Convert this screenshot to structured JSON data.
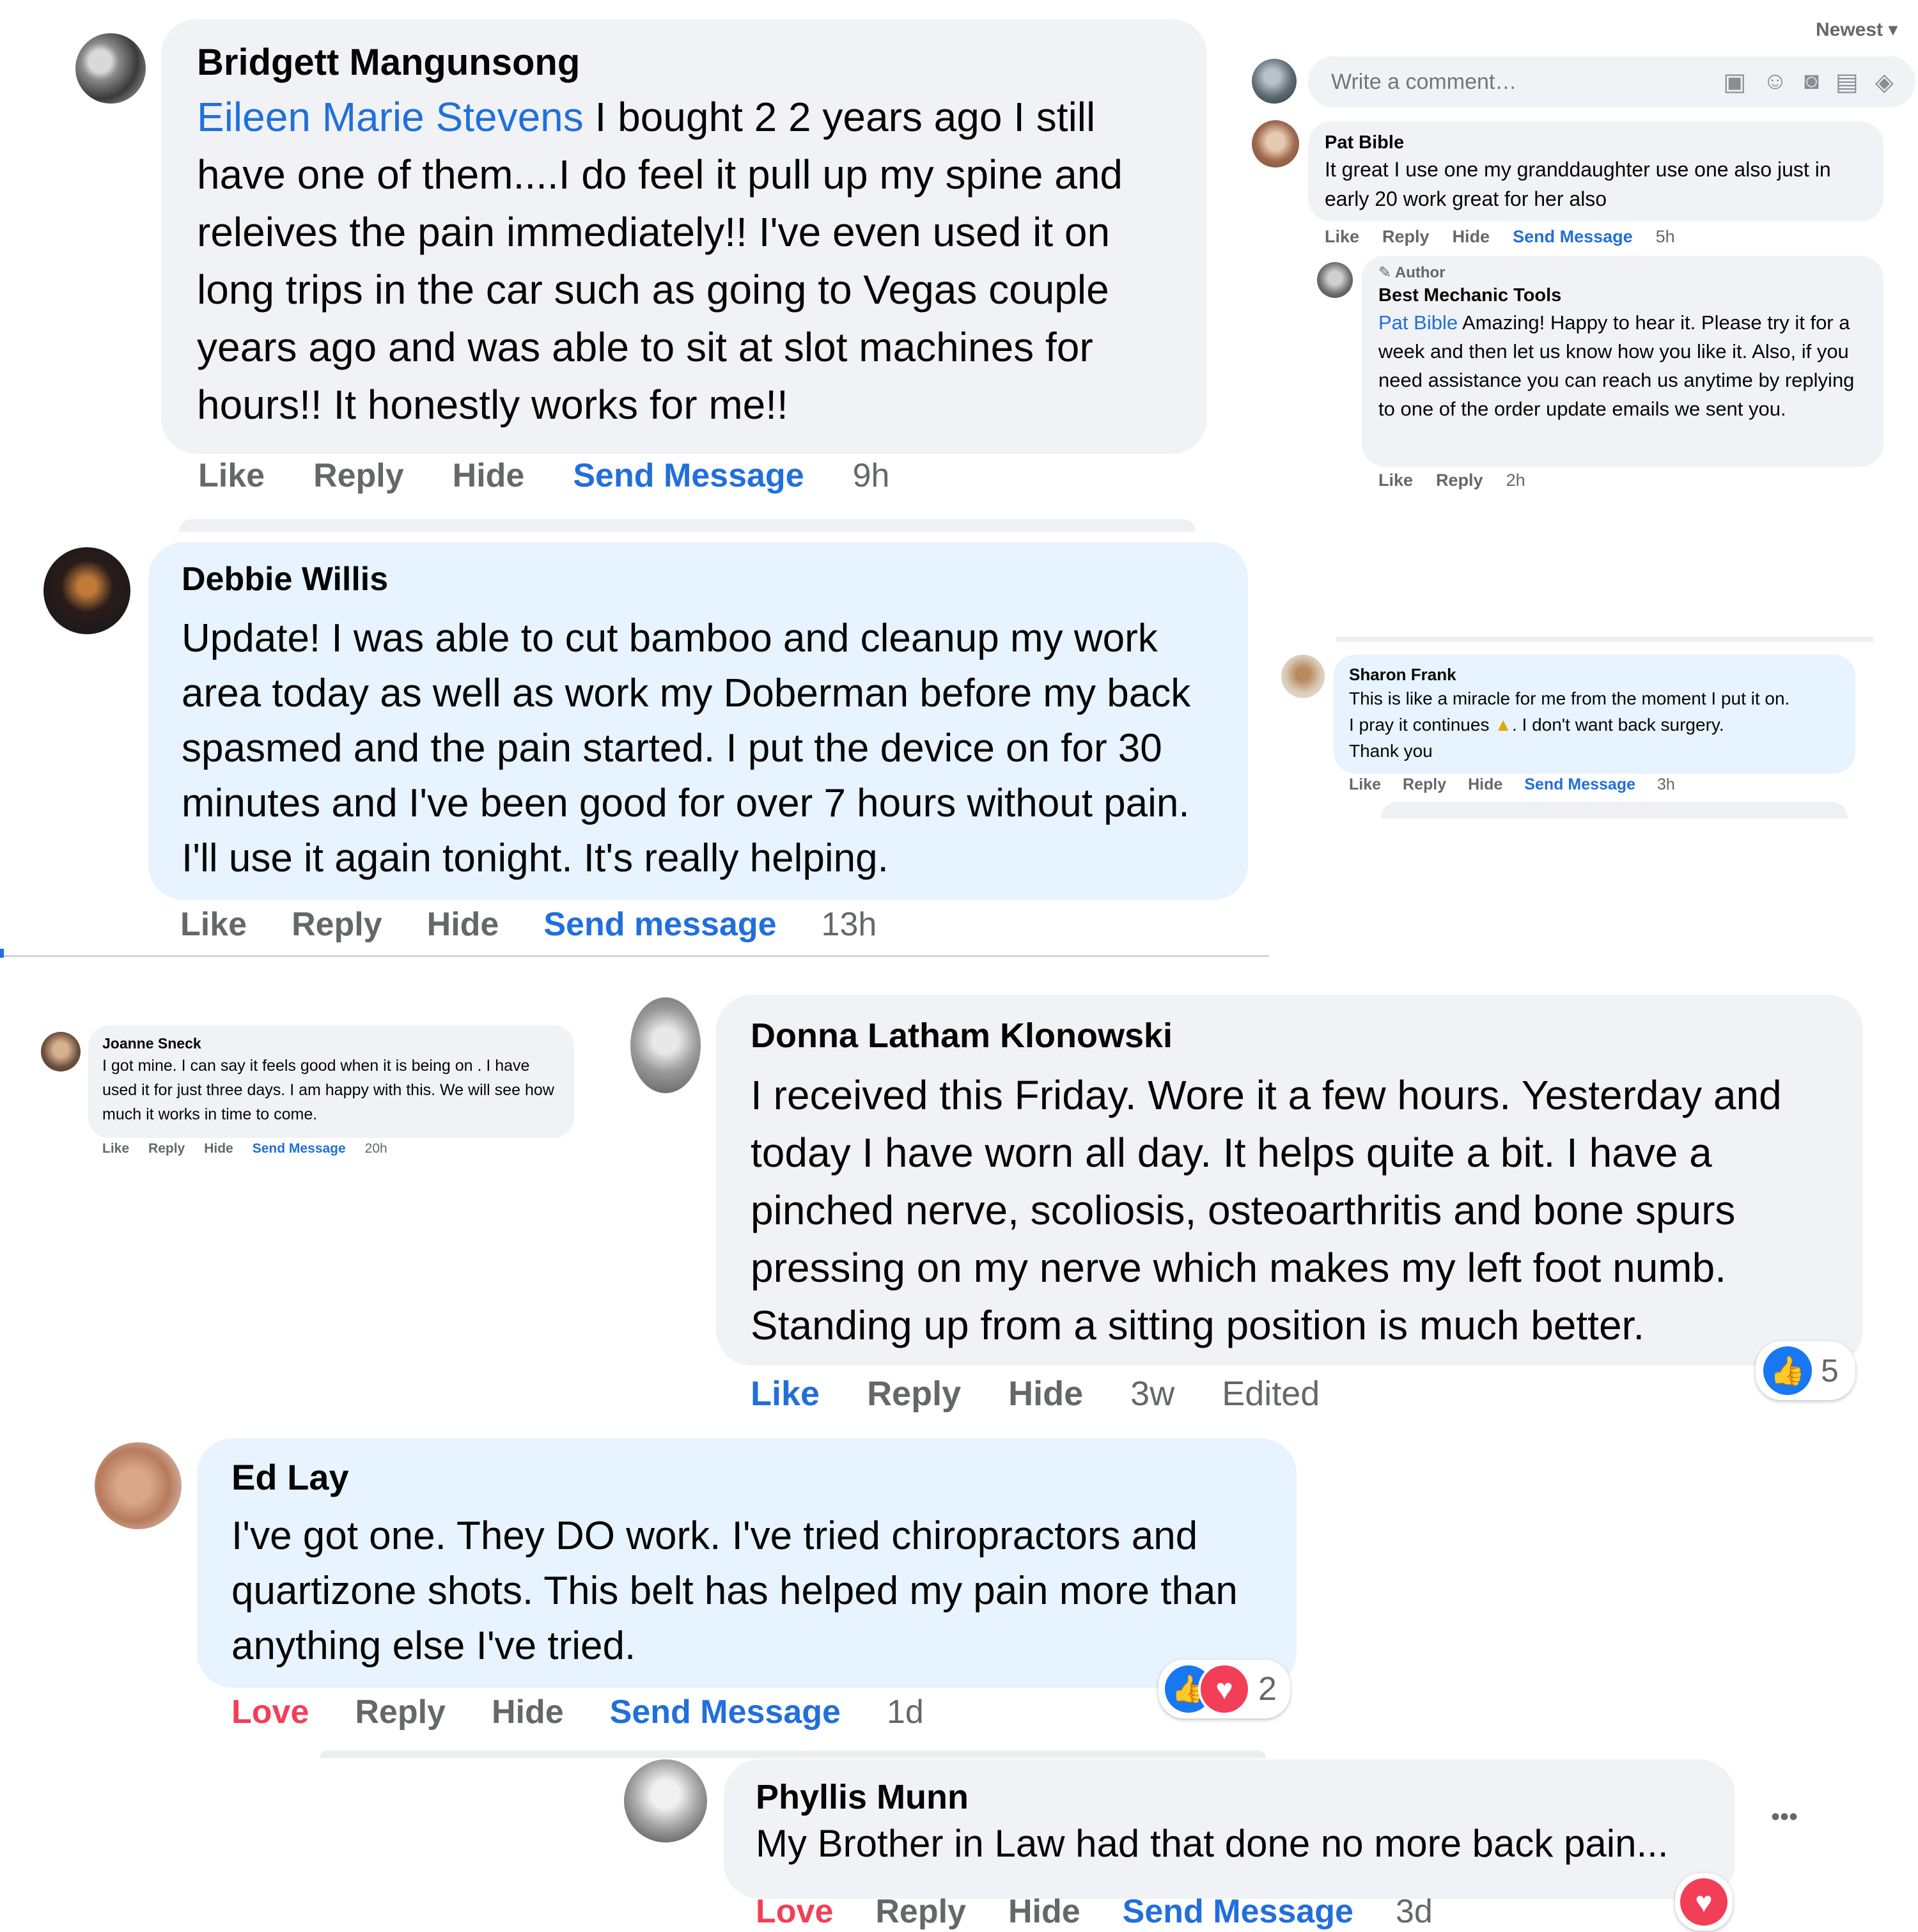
{
  "composer": {
    "placeholder": "Write a comment…",
    "sort_label": "Newest"
  },
  "comments": {
    "bridgett": {
      "name": "Bridgett Mangunsong",
      "mention": "Eileen Marie Stevens",
      "text": "I bought 2 2 years ago I still have one of them....I do feel it pull up my spine and releives the pain immediately!! I've even used it on long trips in the car such as going to Vegas couple years ago and was able to sit at slot machines for hours!! It honestly works for me!!",
      "actions": {
        "like": "Like",
        "reply": "Reply",
        "hide": "Hide",
        "send": "Send Message",
        "time": "9h"
      }
    },
    "debbie": {
      "name": "Debbie Willis",
      "text": "Update! I was able to cut bamboo and cleanup my work area today as well as work my Doberman before my back spasmed and the pain started. I put the device on for 30 minutes and I've been good for over 7 hours without pain. I'll use it again tonight. It's really helping.",
      "actions": {
        "like": "Like",
        "reply": "Reply",
        "hide": "Hide",
        "send": "Send message",
        "time": "13h"
      }
    },
    "pat": {
      "name": "Pat Bible",
      "text": "It great I use one my granddaughter use one also just in early 20 work great for her also",
      "actions": {
        "like": "Like",
        "reply": "Reply",
        "hide": "Hide",
        "send": "Send Message",
        "time": "5h"
      }
    },
    "author_reply": {
      "badge": "Author",
      "name": "Best Mechanic Tools",
      "mention": "Pat Bible",
      "text": "Amazing! Happy to hear it. Please try it for a week and then let us know how you like it. Also, if you need assistance you can reach us anytime by replying to one of the order update emails we sent you.",
      "actions": {
        "like": "Like",
        "reply": "Reply",
        "time": "2h"
      }
    },
    "sharon": {
      "name": "Sharon Frank",
      "line1": "This is like a miracle for me from the moment I put it on.",
      "line2a": "I pray it continues",
      "line2b": ". I don't want back surgery.",
      "line3": "Thank you",
      "actions": {
        "like": "Like",
        "reply": "Reply",
        "hide": "Hide",
        "send": "Send Message",
        "time": "3h"
      }
    },
    "joanne": {
      "name": "Joanne Sneck",
      "text": "I got mine. I can say it feels good when it is being on . I have used it for just three days. I am happy with this. We will see how much it works in time to come.",
      "actions": {
        "like": "Like",
        "reply": "Reply",
        "hide": "Hide",
        "send": "Send Message",
        "time": "20h"
      }
    },
    "donna": {
      "name": "Donna Latham Klonowski",
      "text": "I received this Friday. Wore it a few hours. Yesterday and today I have worn all day. It helps quite a bit. I have a pinched nerve, scoliosis, osteoarthritis and bone spurs pressing on my nerve which makes my left foot numb. Standing up from a sitting position is much better.",
      "actions": {
        "like": "Like",
        "reply": "Reply",
        "hide": "Hide",
        "time": "3w",
        "edited": "Edited"
      },
      "reaction_count": "5"
    },
    "ed": {
      "name": "Ed Lay",
      "text": "I've got one. They DO work. I've tried chiropractors and quartizone shots. This belt has helped my pain more than anything else I've tried.",
      "actions": {
        "love": "Love",
        "reply": "Reply",
        "hide": "Hide",
        "send": "Send Message",
        "time": "1d"
      },
      "reaction_count": "2"
    },
    "phyllis": {
      "name": "Phyllis Munn",
      "text": "My Brother in Law had that done no more back pain...",
      "actions": {
        "love": "Love",
        "reply": "Reply",
        "hide": "Hide",
        "send": "Send Message",
        "time": "3d"
      },
      "more": "•••"
    }
  },
  "colors": {
    "accent": "#216fdb",
    "love": "#f33e58",
    "bubble_gray": "#f0f2f5",
    "bubble_blue": "#e7f3ff",
    "muted": "#65676b"
  }
}
